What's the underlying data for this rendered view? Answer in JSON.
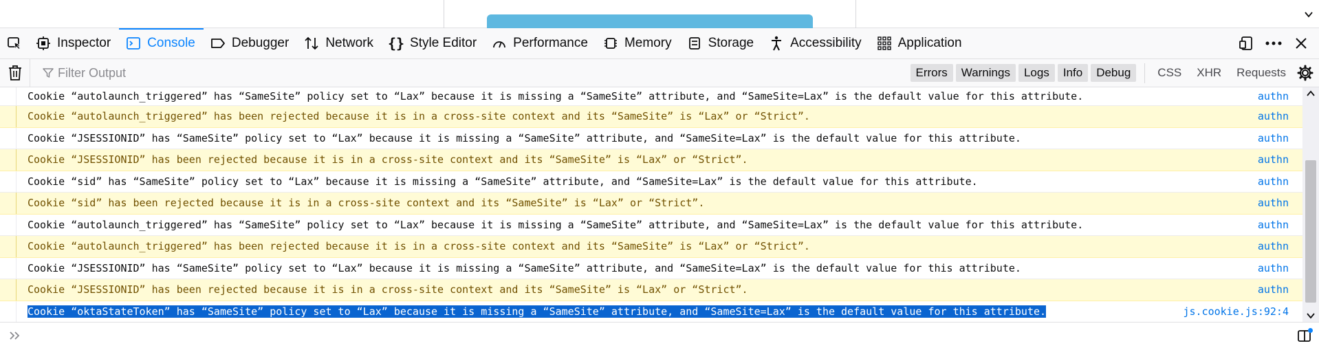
{
  "toolbar": {
    "tabs": [
      {
        "label": "Inspector"
      },
      {
        "label": "Console"
      },
      {
        "label": "Debugger"
      },
      {
        "label": "Network"
      },
      {
        "label": "Style Editor"
      },
      {
        "label": "Performance"
      },
      {
        "label": "Memory"
      },
      {
        "label": "Storage"
      },
      {
        "label": "Accessibility"
      },
      {
        "label": "Application"
      }
    ],
    "active_tab": "Console",
    "accent_color": "#0a84ff"
  },
  "filterbar": {
    "placeholder": "Filter Output",
    "levels": [
      "Errors",
      "Warnings",
      "Logs",
      "Info",
      "Debug"
    ],
    "request_filters": [
      "CSS",
      "XHR",
      "Requests"
    ]
  },
  "messages": [
    {
      "type": "info",
      "text": "Cookie “autolaunch_triggered” has “SameSite” policy set to “Lax” because it is missing a “SameSite” attribute, and “SameSite=Lax” is the default value for this attribute.",
      "source": "authn"
    },
    {
      "type": "warn",
      "text": "Cookie “autolaunch_triggered” has been rejected because it is in a cross-site context and its “SameSite” is “Lax” or “Strict”.",
      "source": "authn"
    },
    {
      "type": "info",
      "text": "Cookie “JSESSIONID” has “SameSite” policy set to “Lax” because it is missing a “SameSite” attribute, and “SameSite=Lax” is the default value for this attribute.",
      "source": "authn"
    },
    {
      "type": "warn",
      "text": "Cookie “JSESSIONID” has been rejected because it is in a cross-site context and its “SameSite” is “Lax” or “Strict”.",
      "source": "authn"
    },
    {
      "type": "info",
      "text": "Cookie “sid” has “SameSite” policy set to “Lax” because it is missing a “SameSite” attribute, and “SameSite=Lax” is the default value for this attribute.",
      "source": "authn"
    },
    {
      "type": "warn",
      "text": "Cookie “sid” has been rejected because it is in a cross-site context and its “SameSite” is “Lax” or “Strict”.",
      "source": "authn"
    },
    {
      "type": "info",
      "text": "Cookie “autolaunch_triggered” has “SameSite” policy set to “Lax” because it is missing a “SameSite” attribute, and “SameSite=Lax” is the default value for this attribute.",
      "source": "authn"
    },
    {
      "type": "warn",
      "text": "Cookie “autolaunch_triggered” has been rejected because it is in a cross-site context and its “SameSite” is “Lax” or “Strict”.",
      "source": "authn"
    },
    {
      "type": "info",
      "text": "Cookie “JSESSIONID” has “SameSite” policy set to “Lax” because it is missing a “SameSite” attribute, and “SameSite=Lax” is the default value for this attribute.",
      "source": "authn"
    },
    {
      "type": "warn",
      "text": "Cookie “JSESSIONID” has been rejected because it is in a cross-site context and its “SameSite” is “Lax” or “Strict”.",
      "source": "authn"
    },
    {
      "type": "selected",
      "text": "Cookie “oktaStateToken” has “SameSite” policy set to “Lax” because it is missing a “SameSite” attribute, and “SameSite=Lax” is the default value for this attribute.",
      "source": "js.cookie.js:92:4"
    }
  ],
  "colors": {
    "warning_bg": "#fffbd6",
    "warning_text": "#715100",
    "link": "#0074e8",
    "selection": "#0a64d0"
  }
}
